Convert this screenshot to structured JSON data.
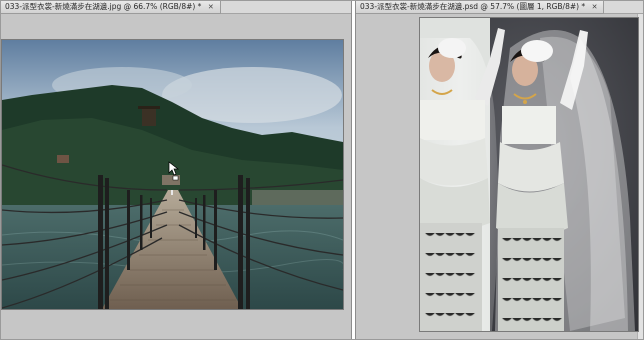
{
  "left_document": {
    "tab_title": "033-派型衣裳-新燒滿步在湖邊.jpg @ 66.7% (RGB/8#) *",
    "close_glyph": "✕"
  },
  "right_document": {
    "tab_title": "033-派型衣裳-新燒滿步在湖邊.psd @ 57.7% (圖層 1, RGB/8#) *",
    "close_glyph": "✕"
  },
  "colors": {
    "workspace_gray": "#c6c6c6",
    "tab_bg": "#dcdcdc",
    "sky": "#9fb6cc",
    "mountain": "#1f3d2b",
    "water": "#3d5d5e",
    "bridge_wood": "#8a7a68",
    "studio_bg": "#3e3f45",
    "dress_white": "#e6e8e4"
  },
  "icons": {
    "cursor": "arrow-cursor-icon"
  }
}
